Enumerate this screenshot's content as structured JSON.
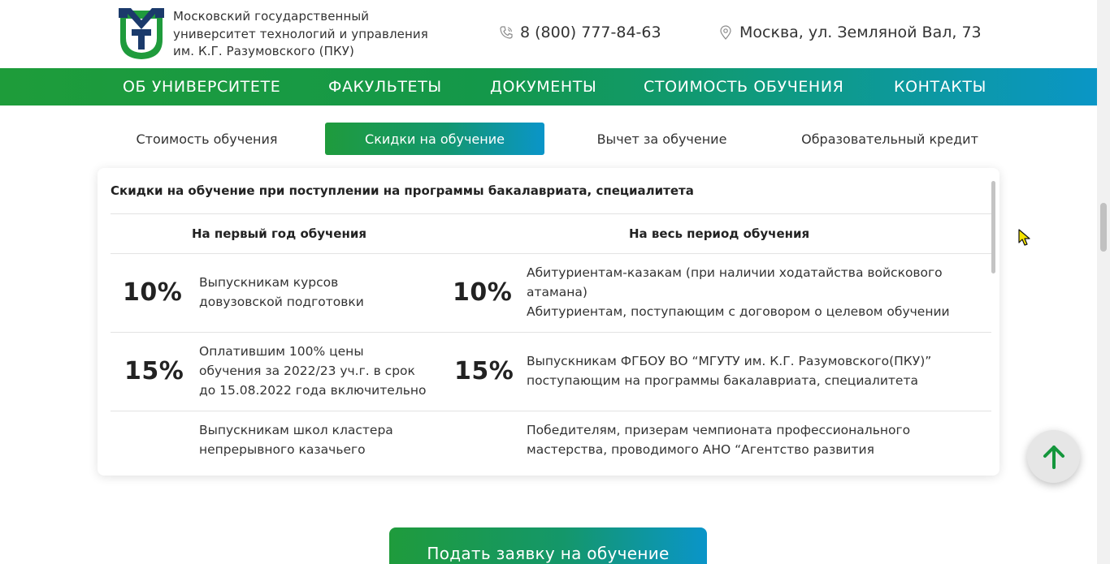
{
  "header": {
    "university_name_line1": "Московский государственный",
    "university_name_line2": "университет технологий и управления",
    "university_name_line3": "им. К.Г. Разумовского (ПКУ)",
    "phone": "8 (800) 777-84-63",
    "address": "Москва, ул. Земляной Вал, 73",
    "icons": {
      "phone": "phone-icon",
      "location": "location-pin-icon"
    }
  },
  "nav": {
    "items": [
      {
        "label": "ОБ УНИВЕРСИТЕТЕ"
      },
      {
        "label": "ФАКУЛЬТЕТЫ"
      },
      {
        "label": "ДОКУМЕНТЫ"
      },
      {
        "label": "СТОИМОСТЬ ОБУЧЕНИЯ"
      },
      {
        "label": "КОНТАКТЫ"
      }
    ]
  },
  "tabs": [
    {
      "label": "Стоимость обучения",
      "active": false
    },
    {
      "label": "Скидки на обучение",
      "active": true
    },
    {
      "label": "Вычет за обучение",
      "active": false
    },
    {
      "label": "Образовательный кредит",
      "active": false
    }
  ],
  "discounts": {
    "title": "Скидки на обучение при поступлении на программы бакалавриата, специалитета",
    "col_first_year": "На первый год обучения",
    "col_full_period": "На весь период обучения",
    "rows": [
      {
        "first_pct": "10%",
        "first_desc_line1": "Выпускникам курсов",
        "first_desc_line2": "довузовской подготовки",
        "full_pct": "10%",
        "full_desc_line1": "Абитуриентам-казакам (при наличии ходатайства войскового",
        "full_desc_line2": "атамана)",
        "full_desc_line3": "Абитуриентам, поступающим с договором о целевом обучении"
      },
      {
        "first_pct": "15%",
        "first_desc_line1": "Оплатившим 100% цены",
        "first_desc_line2": "обучения за 2022/23 уч.г. в срок",
        "first_desc_line3": "до 15.08.2022 года включительно",
        "full_pct": "15%",
        "full_desc_line1": "Выпускникам ФГБОУ ВО “МГУТУ им. К.Г. Разумовского(ПКУ)”",
        "full_desc_line2": "поступающим на программы бакалавриата, специалитета"
      },
      {
        "first_desc_line1": "Выпускникам школ кластера",
        "first_desc_line2": "непрерывного казачьего",
        "full_desc_line1": "Победителям, призерам чемпионата профессионального",
        "full_desc_line2": "мастерства, проводимого АНО “Агентство развития"
      }
    ]
  },
  "submit_label": "Подать заявку на обучение",
  "colors": {
    "brand_green": "#1e9c3a",
    "brand_blue": "#0a96c6",
    "logo_navy": "#1b3a6b"
  }
}
